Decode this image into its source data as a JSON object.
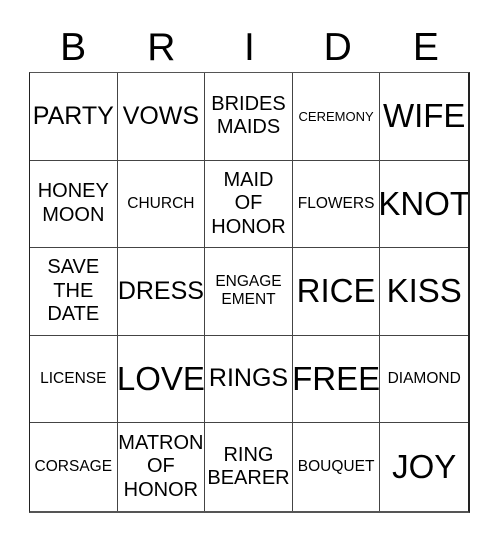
{
  "card": {
    "title_letters": [
      "B",
      "R",
      "I",
      "D",
      "E"
    ],
    "cells": [
      {
        "text": "PARTY",
        "size": "l"
      },
      {
        "text": "VOWS",
        "size": "l"
      },
      {
        "text": "BRIDES\nMAIDS",
        "size": "m"
      },
      {
        "text": "CEREMONY",
        "size": "xs"
      },
      {
        "text": "WIFE",
        "size": "xl"
      },
      {
        "text": "HONEY\nMOON",
        "size": "m"
      },
      {
        "text": "CHURCH",
        "size": "s"
      },
      {
        "text": "MAID\nOF\nHONOR",
        "size": "m"
      },
      {
        "text": "FLOWERS",
        "size": "s"
      },
      {
        "text": "KNOT",
        "size": "xl"
      },
      {
        "text": "SAVE\nTHE\nDATE",
        "size": "m"
      },
      {
        "text": "DRESS",
        "size": "l"
      },
      {
        "text": "ENGAGE\nEMENT",
        "size": "s"
      },
      {
        "text": "RICE",
        "size": "xl"
      },
      {
        "text": "KISS",
        "size": "xl"
      },
      {
        "text": "LICENSE",
        "size": "s"
      },
      {
        "text": "LOVE",
        "size": "xl"
      },
      {
        "text": "RINGS",
        "size": "l"
      },
      {
        "text": "FREE",
        "size": "xl"
      },
      {
        "text": "DIAMOND",
        "size": "s"
      },
      {
        "text": "CORSAGE",
        "size": "s"
      },
      {
        "text": "MATRON\nOF\nHONOR",
        "size": "m"
      },
      {
        "text": "RING\nBEARER",
        "size": "m"
      },
      {
        "text": "BOUQUET",
        "size": "s"
      },
      {
        "text": "JOY",
        "size": "xl"
      }
    ]
  }
}
